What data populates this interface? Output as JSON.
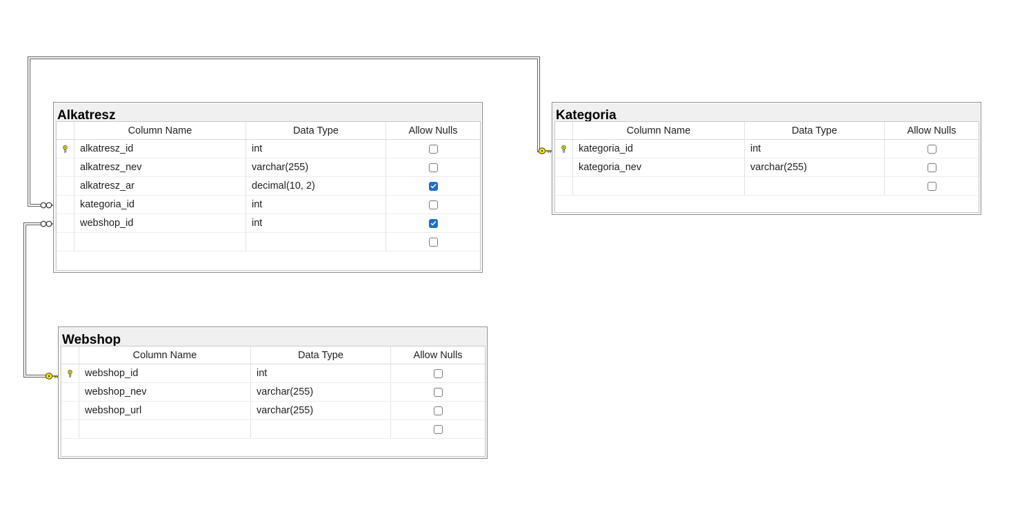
{
  "columns_header": {
    "name": "Column Name",
    "type": "Data Type",
    "nulls": "Allow Nulls"
  },
  "tables": {
    "alkatresz": {
      "title": "Alkatresz",
      "rows": [
        {
          "name": "alkatresz_id",
          "type": "int",
          "allow_nulls": false,
          "primary_key": true
        },
        {
          "name": "alkatresz_nev",
          "type": "varchar(255)",
          "allow_nulls": false,
          "primary_key": false
        },
        {
          "name": "alkatresz_ar",
          "type": "decimal(10, 2)",
          "allow_nulls": true,
          "primary_key": false
        },
        {
          "name": "kategoria_id",
          "type": "int",
          "allow_nulls": false,
          "primary_key": false
        },
        {
          "name": "webshop_id",
          "type": "int",
          "allow_nulls": true,
          "primary_key": false
        },
        {
          "name": "",
          "type": "",
          "allow_nulls": false,
          "primary_key": false
        }
      ]
    },
    "kategoria": {
      "title": "Kategoria",
      "rows": [
        {
          "name": "kategoria_id",
          "type": "int",
          "allow_nulls": false,
          "primary_key": true
        },
        {
          "name": "kategoria_nev",
          "type": "varchar(255)",
          "allow_nulls": false,
          "primary_key": false
        },
        {
          "name": "",
          "type": "",
          "allow_nulls": false,
          "primary_key": false
        }
      ]
    },
    "webshop": {
      "title": "Webshop",
      "rows": [
        {
          "name": "webshop_id",
          "type": "int",
          "allow_nulls": false,
          "primary_key": true
        },
        {
          "name": "webshop_nev",
          "type": "varchar(255)",
          "allow_nulls": false,
          "primary_key": false
        },
        {
          "name": "webshop_url",
          "type": "varchar(255)",
          "allow_nulls": false,
          "primary_key": false
        },
        {
          "name": "",
          "type": "",
          "allow_nulls": false,
          "primary_key": false
        }
      ]
    }
  },
  "relationships": [
    {
      "from_table": "Alkatresz",
      "from_column": "kategoria_id",
      "to_table": "Kategoria",
      "to_column": "kategoria_id"
    },
    {
      "from_table": "Alkatresz",
      "from_column": "webshop_id",
      "to_table": "Webshop",
      "to_column": "webshop_id"
    }
  ],
  "colors": {
    "key_icon": "#f2e600",
    "checkbox_checked": "#1f6fc5",
    "title_bar": "#f0f0f0",
    "connector": "#5a5a5a"
  }
}
